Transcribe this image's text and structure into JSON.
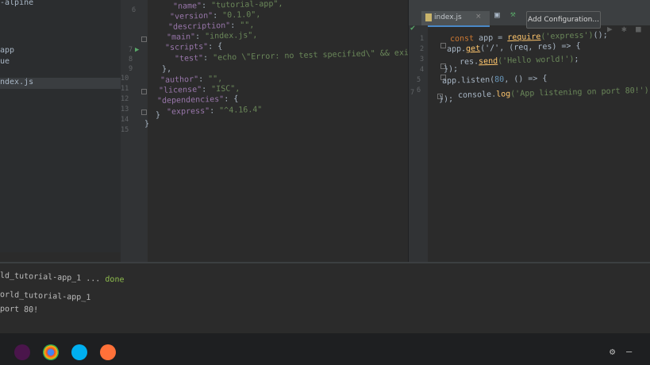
{
  "project_tree": {
    "items": [
      {
        "label": "-alpine"
      },
      {
        "label": "app"
      },
      {
        "label": "ue"
      },
      {
        "label": "ndex.js"
      }
    ]
  },
  "package_editor": {
    "line_numbers": [
      "6",
      "7",
      "8",
      "9",
      "10",
      "11",
      "12",
      "13",
      "14",
      "15"
    ],
    "lines": [
      {
        "key": "\"name\"",
        "value": "\"tutorial-app\","
      },
      {
        "key": "\"version\"",
        "value": "\"0.1.0\","
      },
      {
        "key": "\"description\"",
        "value": "\"\","
      },
      {
        "key": "\"main\"",
        "value": "\"index.js\","
      },
      {
        "key": "\"scripts\"",
        "value": "{"
      },
      {
        "key": "\"test\"",
        "value": "\"echo \\\"Error: no test specified\\\" && exit 1\""
      },
      {
        "key": "",
        "value": "},"
      },
      {
        "key": "\"author\"",
        "value": "\"\","
      },
      {
        "key": "\"license\"",
        "value": "\"ISC\","
      },
      {
        "key": "\"dependencies\"",
        "value": "{"
      },
      {
        "key": "\"express\"",
        "value": "\"^4.16.4\""
      },
      {
        "key": "",
        "value": "}"
      },
      {
        "key": "",
        "value": "}"
      }
    ]
  },
  "index_editor": {
    "tab_label": "index.js",
    "config_button": "Add Configuration...",
    "line_numbers": [
      "1",
      "2",
      "3",
      "4",
      "5",
      "6",
      "7"
    ],
    "code": {
      "l1_kw": "const",
      "l1_rest": " app = ",
      "l1_fn": "require",
      "l1_str": "('express')",
      "l1_end": "();",
      "l2_a": "app.",
      "l2_fn": "get",
      "l2_b": "('/', (req, res) => {",
      "l3_a": "res.",
      "l3_fn": "send",
      "l3_str": "('Hello world!')",
      "l3_end": ";",
      "l4": "});",
      "l5_a": "app.listen(",
      "l5_num": "80",
      "l5_b": ", () => {",
      "l6_a": "console.",
      "l6_fn": "log",
      "l6_str": "('App listening on port 80!')",
      "l6_end": ";",
      "l7": "});"
    }
  },
  "run_panel": {
    "line1": "ld_tutorial-app_1 ... ",
    "line1_status": "done",
    "line2": "orld_tutorial-app_1",
    "line3": "port 80!"
  }
}
